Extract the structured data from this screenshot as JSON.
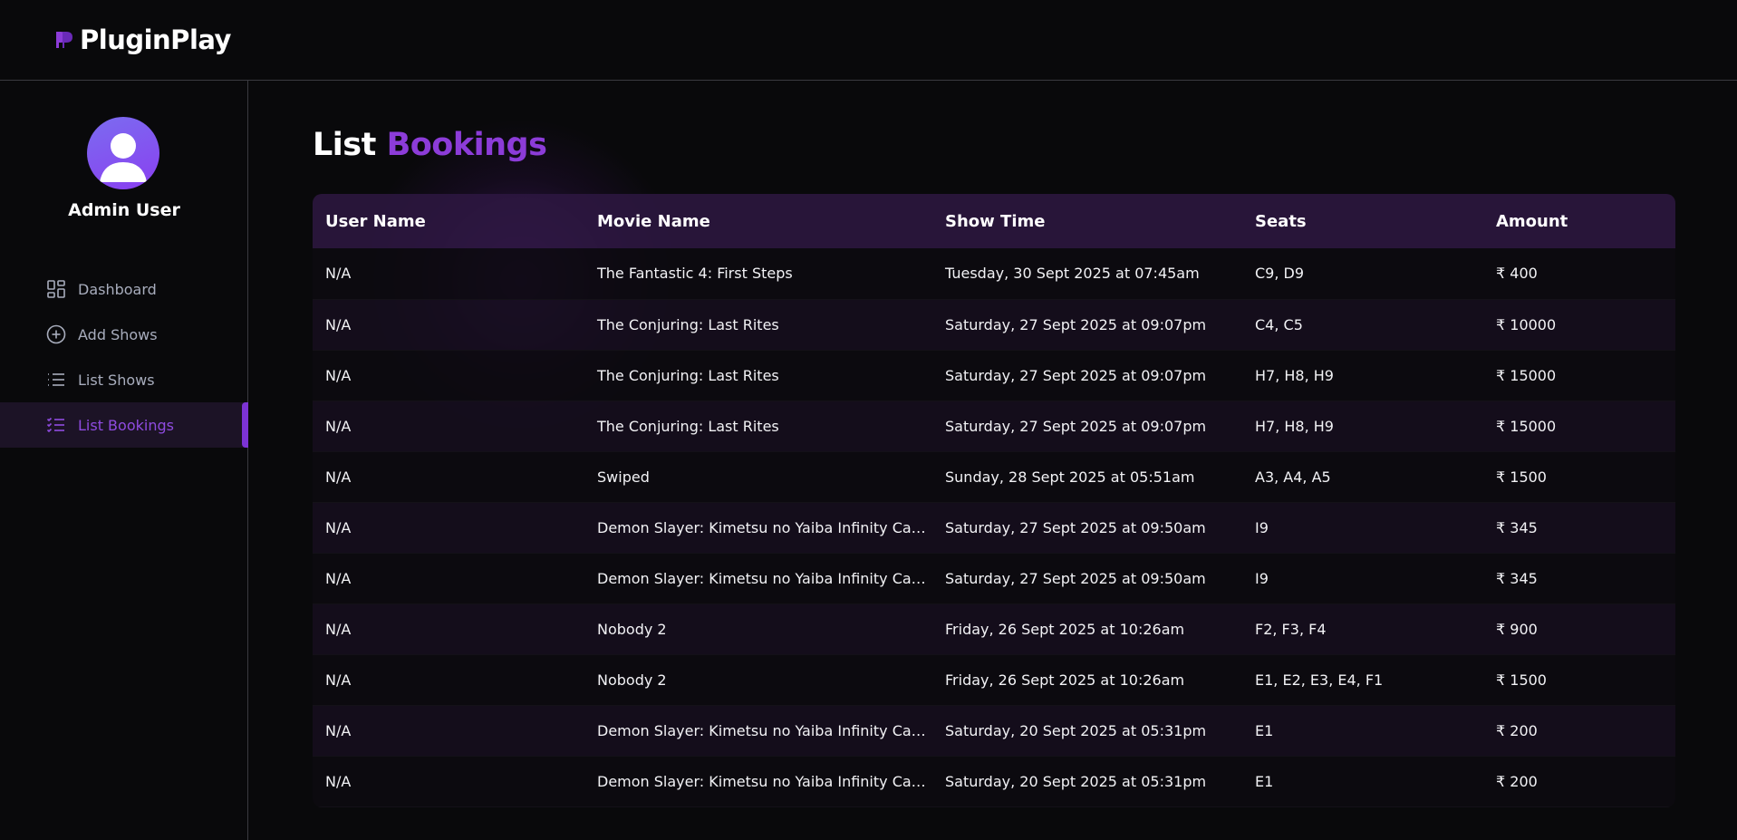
{
  "app": {
    "name": "PluginPlay",
    "accent": "#8c3cd8"
  },
  "sidebar": {
    "user_name": "Admin User",
    "items": [
      {
        "label": "Dashboard",
        "icon": "dashboard-icon"
      },
      {
        "label": "Add Shows",
        "icon": "plus-circle-icon"
      },
      {
        "label": "List Shows",
        "icon": "list-icon"
      },
      {
        "label": "List Bookings",
        "icon": "list-check-icon",
        "active": true
      }
    ]
  },
  "page": {
    "title_main": "List",
    "title_accent": "Bookings"
  },
  "table": {
    "headers": [
      "User Name",
      "Movie Name",
      "Show Time",
      "Seats",
      "Amount"
    ],
    "rows": [
      [
        "N/A",
        "The Fantastic 4: First Steps",
        "Tuesday, 30 Sept 2025 at 07:45am",
        "C9, D9",
        "₹ 400"
      ],
      [
        "N/A",
        "The Conjuring: Last Rites",
        "Saturday, 27 Sept 2025 at 09:07pm",
        "C4, C5",
        "₹ 10000"
      ],
      [
        "N/A",
        "The Conjuring: Last Rites",
        "Saturday, 27 Sept 2025 at 09:07pm",
        "H7, H8, H9",
        "₹ 15000"
      ],
      [
        "N/A",
        "The Conjuring: Last Rites",
        "Saturday, 27 Sept 2025 at 09:07pm",
        "H7, H8, H9",
        "₹ 15000"
      ],
      [
        "N/A",
        "Swiped",
        "Sunday, 28 Sept 2025 at 05:51am",
        "A3, A4, A5",
        "₹ 1500"
      ],
      [
        "N/A",
        "Demon Slayer: Kimetsu no Yaiba Infinity Cas...",
        "Saturday, 27 Sept 2025 at 09:50am",
        "I9",
        "₹ 345"
      ],
      [
        "N/A",
        "Demon Slayer: Kimetsu no Yaiba Infinity Cas...",
        "Saturday, 27 Sept 2025 at 09:50am",
        "I9",
        "₹ 345"
      ],
      [
        "N/A",
        "Nobody 2",
        "Friday, 26 Sept 2025 at 10:26am",
        "F2, F3, F4",
        "₹ 900"
      ],
      [
        "N/A",
        "Nobody 2",
        "Friday, 26 Sept 2025 at 10:26am",
        "E1, E2, E3, E4, F1",
        "₹ 1500"
      ],
      [
        "N/A",
        "Demon Slayer: Kimetsu no Yaiba Infinity Cas...",
        "Saturday, 20 Sept 2025 at 05:31pm",
        "E1",
        "₹ 200"
      ],
      [
        "N/A",
        "Demon Slayer: Kimetsu no Yaiba Infinity Cas...",
        "Saturday, 20 Sept 2025 at 05:31pm",
        "E1",
        "₹ 200"
      ]
    ]
  }
}
